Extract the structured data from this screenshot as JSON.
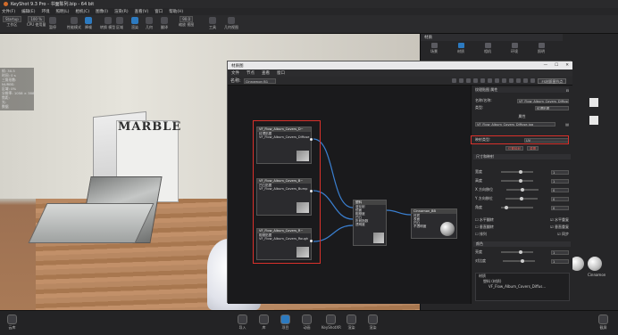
{
  "window": {
    "title": "KeyShot 9.3 Pro - 书面陈列.bip - 64 bit"
  },
  "menu": [
    "文件(F)",
    "编辑(E)",
    "环境",
    "照明(L)",
    "相机(C)",
    "图像(I)",
    "渲染(R)",
    "查看(V)",
    "窗口",
    "帮助(H)"
  ],
  "toolbar": {
    "workspace": "Startup",
    "cpu_usage": "100 %",
    "zoom": "90.0",
    "items": [
      "工作区",
      "CPU 使用量",
      "暂停",
      "性能模式",
      "降噪",
      "转换 模型",
      "区域",
      "渲染",
      "几何",
      "翻译",
      "平移",
      "移动",
      "缩放 视图",
      "工具",
      "几何视图"
    ]
  },
  "hud": [
    "帧: 30.5",
    "时间: 0 s",
    "三角形数:",
    "NURBS:",
    "区域: 0%",
    "分辨率: 1058 × 388",
    "焦距:",
    "光:",
    "数据"
  ],
  "viewport": {
    "book_title": "MARBLE"
  },
  "right_panel": {
    "header": "材质",
    "tabs": [
      "场景",
      "材质",
      "相机",
      "环境",
      "照明",
      "图像"
    ],
    "material_label": "Material"
  },
  "material_graph": {
    "window_title": "材质图",
    "menu": [
      "文件",
      "节点",
      "查看",
      "窗口"
    ],
    "name_label": "名称:",
    "name_value": "Cinnamon B1",
    "tag_button": "FS材质图节点",
    "nodes": [
      {
        "title": "VF_Flow_Album_Covers_D~",
        "sub": "纹理贴图",
        "lines": [
          "VF_Flow_Album_Covers_Diffuse"
        ]
      },
      {
        "title": "VF_Flow_Album_Covers_B~",
        "sub": "凹凸贴图",
        "lines": [
          "VF_Flow_Album_Covers_Bump"
        ]
      },
      {
        "title": "VF_Flow_Album_Covers_R~",
        "sub": "粗糙贴图",
        "lines": [
          "VF_Flow_Album_Covers_Rough"
        ]
      },
      {
        "title": "塑料",
        "sub": "",
        "lines": [
          "漫反射",
          "镜面",
          "粗糙度",
          "凹凸",
          "折射指数",
          "透明度"
        ]
      },
      {
        "title": "Cinnamon_BB",
        "sub": "",
        "lines": [
          "材质",
          "表面",
          "凹凸",
          "不透明度",
          "标签"
        ]
      }
    ]
  },
  "properties": {
    "header": "纹理贴图 属性",
    "name_label": "名称/名称:",
    "name_value": "VF_Flow_Album_Covers_Diffuse",
    "type_label": "类型:",
    "type_value": "纹理贴图",
    "section_texture": "属性",
    "file_value": "VF_Flow_Album_Covers_Diffuse.jpg",
    "mapping_label": "映射类型:",
    "mapping_value": "UV",
    "link_buttons": [
      "位置映射",
      "重置"
    ],
    "size_section": "尺寸和映射",
    "rows": [
      {
        "label": "宽度",
        "value": "1"
      },
      {
        "label": "高度",
        "value": "1"
      },
      {
        "label": "X 方向移位",
        "value": "0"
      },
      {
        "label": "Y 方向移位",
        "value": "0"
      },
      {
        "label": "角度",
        "value": "0"
      }
    ],
    "checks": [
      "水平翻转",
      "水平重复",
      "垂直翻转",
      "垂直重复",
      "排列",
      "同步"
    ],
    "color_section": "颜色",
    "color_rows": [
      {
        "label": "亮度",
        "value": "1"
      },
      {
        "label": "对比度",
        "value": "1"
      }
    ],
    "tree": [
      "材质",
      "塑料 (材质)",
      "VF_Flow_Album_Covers_Diffus..."
    ]
  },
  "bottom": {
    "left": "云库",
    "center": [
      "导入",
      "库",
      "项目",
      "动画",
      "KeyShotXR",
      "渲染",
      "渲染"
    ],
    "right": "截屏"
  },
  "right_swatch_label": "Cinnamon",
  "colors": {
    "accent": "#2c7ac0",
    "highlight": "#d9312b",
    "bg": "#1e1e20"
  }
}
